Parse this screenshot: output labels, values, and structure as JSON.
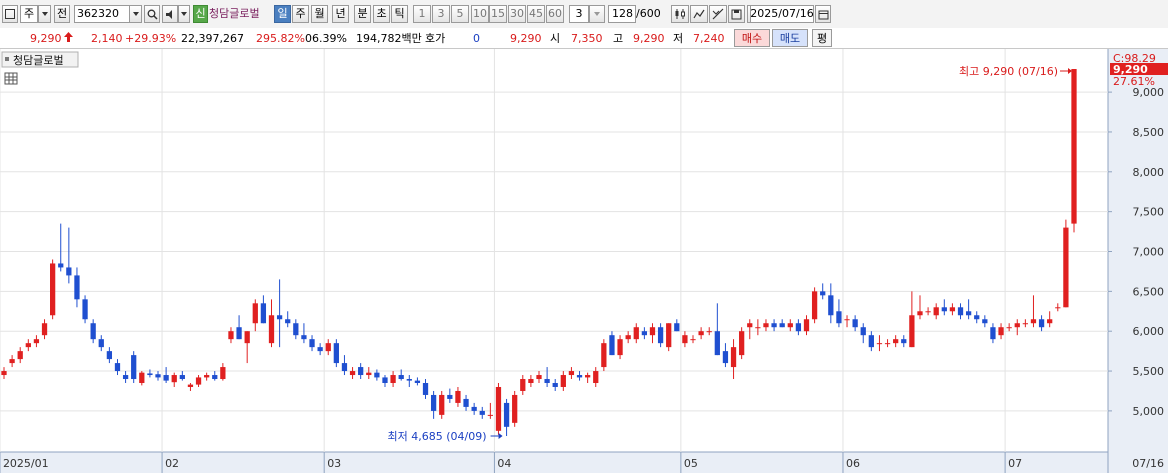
{
  "toolbar": {
    "chart_type": "주",
    "mode": "전",
    "code": "362320",
    "new_badge": "신",
    "stock_name": "청담글로벌",
    "periods": [
      "일",
      "주",
      "월",
      "년",
      "분",
      "초",
      "틱"
    ],
    "selected_period": "일",
    "intervals": [
      "1",
      "3",
      "5",
      "10",
      "15",
      "30",
      "45",
      "60"
    ],
    "interval_value": "3",
    "count": "128",
    "count_max": "/600",
    "date": "2025/07/16"
  },
  "quote": {
    "price": "9,290",
    "change": "2,140",
    "change_pct": "+29.93%",
    "volume": "22,397,267",
    "volume_ratio": "295.82%",
    "turnover": "06.39%",
    "amount": "194,782백만",
    "hoga_label": "호가",
    "hoga_value": "0",
    "hoga_price": "9,290",
    "open_label": "시",
    "open": "7,350",
    "high_label": "고",
    "high": "9,290",
    "low_label": "저",
    "low": "7,240",
    "buy_label": "매수",
    "sell_label": "매도",
    "avg_label": "평"
  },
  "colors": {
    "up": "#e02020",
    "down": "#1f4fd0",
    "accent": "#4a7fc0"
  },
  "chart_data": {
    "type": "candlestick",
    "title": "청담글로벌",
    "price_label_value": "9,290",
    "price_label_pct": "27.61%",
    "price_label_c": "C:98.29",
    "annotations": {
      "high": {
        "text": "최고 9,290 (07/16)",
        "value": 9290,
        "date": "07/16"
      },
      "low": {
        "text": "최저 4,685 (04/09)",
        "value": 4685,
        "date": "04/09"
      }
    },
    "x_labels": [
      "2025/01",
      "02",
      "03",
      "04",
      "05",
      "06",
      "07",
      "07/16"
    ],
    "y_ticks": [
      5000,
      5500,
      6000,
      6500,
      7000,
      7500,
      8000,
      8500,
      9000
    ],
    "ylim": [
      4500,
      9400
    ],
    "month_starts": [
      0,
      20,
      40,
      61,
      84,
      104,
      124
    ],
    "candles": [
      [
        5450,
        5550,
        5400,
        5500
      ],
      [
        5600,
        5700,
        5550,
        5650
      ],
      [
        5650,
        5800,
        5600,
        5750
      ],
      [
        5800,
        5900,
        5750,
        5850
      ],
      [
        5850,
        5950,
        5800,
        5900
      ],
      [
        5950,
        6150,
        5900,
        6100
      ],
      [
        6200,
        6900,
        6150,
        6850
      ],
      [
        6850,
        7350,
        6750,
        6800
      ],
      [
        6800,
        7300,
        6600,
        6700
      ],
      [
        6700,
        6800,
        6300,
        6400
      ],
      [
        6400,
        6450,
        6100,
        6150
      ],
      [
        6100,
        6150,
        5850,
        5900
      ],
      [
        5900,
        5950,
        5750,
        5800
      ],
      [
        5750,
        5800,
        5600,
        5650
      ],
      [
        5600,
        5650,
        5450,
        5500
      ],
      [
        5450,
        5500,
        5350,
        5400
      ],
      [
        5700,
        5750,
        5350,
        5400
      ],
      [
        5350,
        5500,
        5320,
        5480
      ],
      [
        5470,
        5520,
        5420,
        5450
      ],
      [
        5460,
        5500,
        5380,
        5420
      ],
      [
        5450,
        5550,
        5350,
        5380
      ],
      [
        5360,
        5480,
        5300,
        5450
      ],
      [
        5450,
        5500,
        5380,
        5400
      ],
      [
        5300,
        5350,
        5250,
        5330
      ],
      [
        5330,
        5450,
        5300,
        5420
      ],
      [
        5420,
        5480,
        5380,
        5450
      ],
      [
        5450,
        5500,
        5380,
        5400
      ],
      [
        5400,
        5600,
        5380,
        5550
      ],
      [
        5900,
        6050,
        5850,
        6000
      ],
      [
        6050,
        6200,
        5900,
        5900
      ],
      [
        5850,
        6000,
        5600,
        6000
      ],
      [
        6100,
        6400,
        6000,
        6350
      ],
      [
        6350,
        6450,
        6100,
        6100
      ],
      [
        5850,
        6400,
        5800,
        6200
      ],
      [
        6200,
        6650,
        5800,
        6150
      ],
      [
        6150,
        6250,
        6050,
        6100
      ],
      [
        6100,
        6150,
        5900,
        5950
      ],
      [
        5950,
        6100,
        5850,
        5900
      ],
      [
        5900,
        5950,
        5750,
        5800
      ],
      [
        5800,
        5850,
        5700,
        5750
      ],
      [
        5750,
        5900,
        5700,
        5850
      ],
      [
        5850,
        5900,
        5550,
        5600
      ],
      [
        5600,
        5700,
        5450,
        5500
      ],
      [
        5450,
        5550,
        5400,
        5500
      ],
      [
        5550,
        5600,
        5400,
        5450
      ],
      [
        5450,
        5550,
        5400,
        5480
      ],
      [
        5480,
        5520,
        5380,
        5420
      ],
      [
        5420,
        5450,
        5300,
        5350
      ],
      [
        5350,
        5500,
        5300,
        5450
      ],
      [
        5450,
        5520,
        5380,
        5400
      ],
      [
        5400,
        5450,
        5300,
        5380
      ],
      [
        5380,
        5420,
        5320,
        5350
      ],
      [
        5350,
        5400,
        5150,
        5200
      ],
      [
        5200,
        5250,
        4900,
        5000
      ],
      [
        4950,
        5250,
        4900,
        5200
      ],
      [
        5200,
        5280,
        5100,
        5150
      ],
      [
        5100,
        5300,
        5050,
        5250
      ],
      [
        5150,
        5200,
        5000,
        5050
      ],
      [
        5050,
        5100,
        4950,
        5000
      ],
      [
        5000,
        5050,
        4900,
        4950
      ],
      [
        4950,
        5100,
        4900,
        4950
      ],
      [
        4750,
        5350,
        4700,
        5300
      ],
      [
        5100,
        5150,
        4685,
        4800
      ],
      [
        4850,
        5250,
        4800,
        5200
      ],
      [
        5250,
        5450,
        5200,
        5400
      ],
      [
        5350,
        5450,
        5300,
        5400
      ],
      [
        5400,
        5500,
        5350,
        5450
      ],
      [
        5400,
        5550,
        5300,
        5350
      ],
      [
        5350,
        5400,
        5250,
        5300
      ],
      [
        5300,
        5500,
        5250,
        5450
      ],
      [
        5450,
        5550,
        5400,
        5500
      ],
      [
        5450,
        5500,
        5380,
        5420
      ],
      [
        5420,
        5480,
        5350,
        5450
      ],
      [
        5350,
        5550,
        5300,
        5500
      ],
      [
        5550,
        5900,
        5500,
        5850
      ],
      [
        5950,
        6000,
        5700,
        5700
      ],
      [
        5700,
        5950,
        5650,
        5900
      ],
      [
        5900,
        6000,
        5850,
        5950
      ],
      [
        5900,
        6100,
        5850,
        6050
      ],
      [
        6000,
        6050,
        5900,
        5950
      ],
      [
        5950,
        6100,
        5850,
        6050
      ],
      [
        6050,
        6100,
        5800,
        5850
      ],
      [
        5800,
        6100,
        5750,
        6100
      ],
      [
        6100,
        6150,
        6000,
        6000
      ],
      [
        5850,
        6000,
        5800,
        5950
      ],
      [
        5900,
        5950,
        5850,
        5900
      ],
      [
        5950,
        6050,
        5900,
        6000
      ],
      [
        6000,
        6050,
        5950,
        6000
      ],
      [
        6000,
        6350,
        5700,
        5700
      ],
      [
        5750,
        5850,
        5550,
        5600
      ],
      [
        5550,
        5900,
        5400,
        5800
      ],
      [
        5700,
        6050,
        5650,
        6000
      ],
      [
        6050,
        6150,
        5900,
        6100
      ],
      [
        6050,
        6150,
        5950,
        6050
      ],
      [
        6050,
        6150,
        6000,
        6100
      ],
      [
        6100,
        6150,
        6000,
        6050
      ],
      [
        6100,
        6150,
        6050,
        6050
      ],
      [
        6050,
        6150,
        6000,
        6100
      ],
      [
        6100,
        6150,
        5950,
        6000
      ],
      [
        6000,
        6200,
        5950,
        6150
      ],
      [
        6150,
        6550,
        6100,
        6500
      ],
      [
        6500,
        6600,
        6400,
        6450
      ],
      [
        6450,
        6600,
        6100,
        6200
      ],
      [
        6250,
        6400,
        6050,
        6100
      ],
      [
        6150,
        6200,
        6050,
        6150
      ],
      [
        6150,
        6200,
        6000,
        6050
      ],
      [
        6050,
        6100,
        5850,
        5950
      ],
      [
        5950,
        6000,
        5750,
        5800
      ],
      [
        5850,
        5950,
        5750,
        5850
      ],
      [
        5850,
        5900,
        5800,
        5850
      ],
      [
        5850,
        5950,
        5800,
        5900
      ],
      [
        5900,
        5950,
        5800,
        5850
      ],
      [
        5800,
        6500,
        5800,
        6200
      ],
      [
        6200,
        6450,
        6150,
        6250
      ],
      [
        6250,
        6300,
        6200,
        6250
      ],
      [
        6200,
        6350,
        6150,
        6300
      ],
      [
        6300,
        6400,
        6200,
        6250
      ],
      [
        6250,
        6350,
        6200,
        6300
      ],
      [
        6300,
        6350,
        6150,
        6200
      ],
      [
        6250,
        6400,
        6150,
        6200
      ],
      [
        6200,
        6250,
        6100,
        6150
      ],
      [
        6150,
        6200,
        6050,
        6100
      ],
      [
        6050,
        6100,
        5850,
        5900
      ],
      [
        5950,
        6100,
        5900,
        6050
      ],
      [
        6050,
        6100,
        6000,
        6050
      ],
      [
        6050,
        6150,
        5950,
        6100
      ],
      [
        6100,
        6150,
        6050,
        6100
      ],
      [
        6100,
        6450,
        6050,
        6150
      ],
      [
        6150,
        6200,
        6000,
        6050
      ],
      [
        6100,
        6250,
        6050,
        6150
      ],
      [
        6300,
        6350,
        6250,
        6300
      ],
      [
        6300,
        7400,
        6300,
        7300
      ],
      [
        7350,
        9290,
        7240,
        9290
      ]
    ]
  }
}
